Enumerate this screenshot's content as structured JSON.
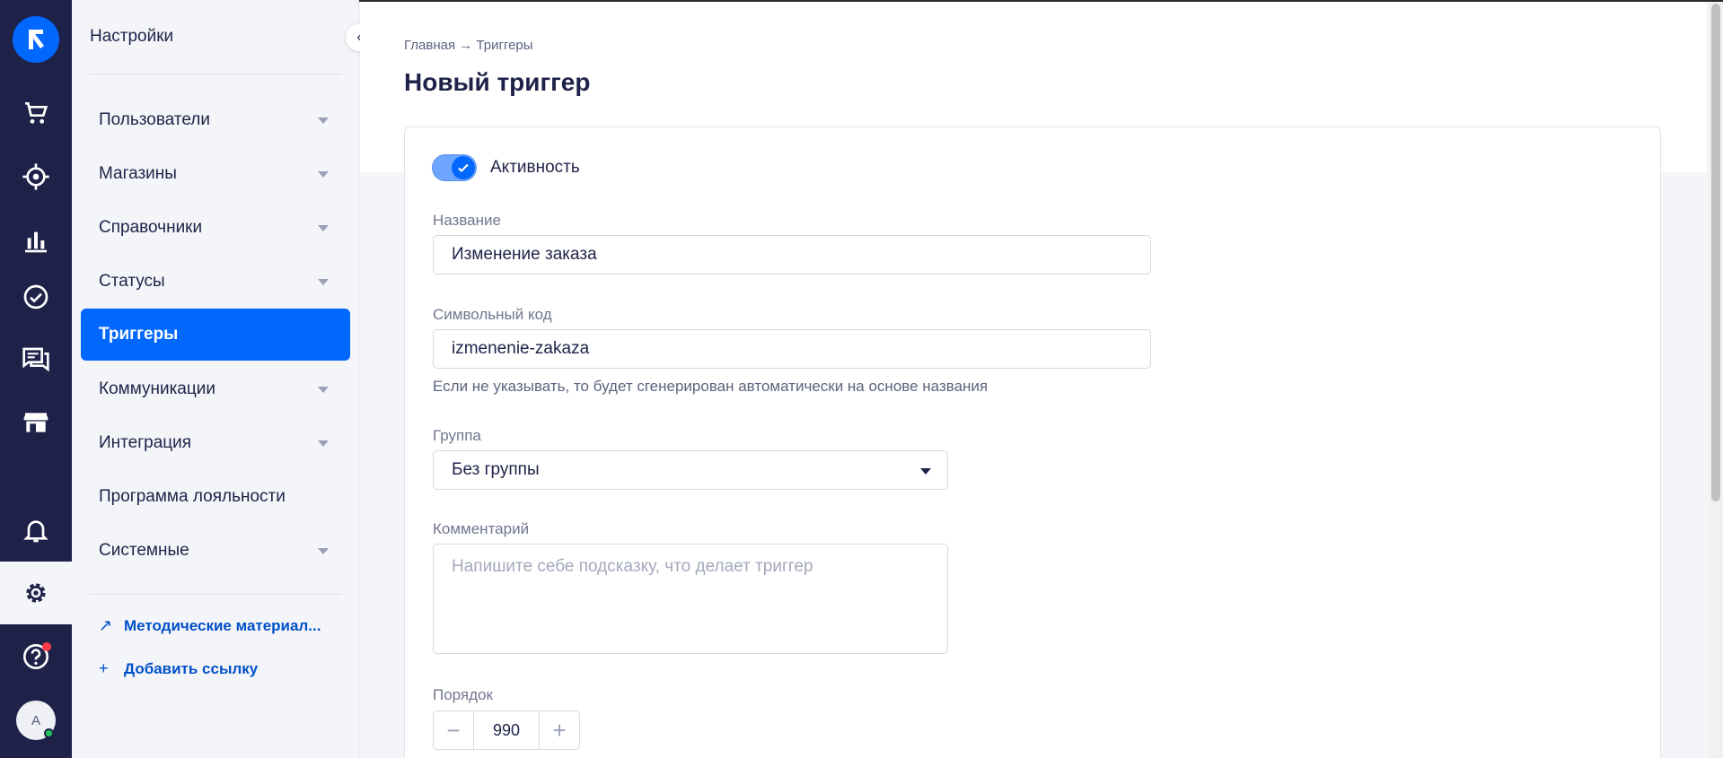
{
  "sidebar": {
    "title": "Настройки",
    "items": [
      {
        "label": "Пользователи",
        "has_submenu": true
      },
      {
        "label": "Магазины",
        "has_submenu": true
      },
      {
        "label": "Справочники",
        "has_submenu": true
      },
      {
        "label": "Статусы",
        "has_submenu": true
      },
      {
        "label": "Триггеры",
        "active": true
      },
      {
        "label": "Коммуникации",
        "has_submenu": true
      },
      {
        "label": "Интеграция",
        "has_submenu": true
      },
      {
        "label": "Программа лояльности"
      },
      {
        "label": "Системные",
        "has_submenu": true
      }
    ],
    "links": [
      {
        "label": "Методические материал...",
        "icon": "arrow-up-right-icon"
      },
      {
        "label": "Добавить ссылку",
        "icon": "plus-icon"
      }
    ]
  },
  "rail": {
    "avatar_initial": "A",
    "icons": [
      "logo-icon",
      "cart-icon",
      "target-icon",
      "bar-chart-icon",
      "check-circle-icon",
      "chat-icon",
      "store-icon",
      "bell-icon",
      "gear-icon",
      "help-icon"
    ]
  },
  "header": {
    "breadcrumb": "Главная → Триггеры",
    "title": "Новый триггер"
  },
  "form": {
    "activity_label": "Активность",
    "activity_on": true,
    "name_label": "Название",
    "name_value": "Изменение заказа",
    "code_label": "Символьный код",
    "code_value": "izmenenie-zakaza",
    "code_hint": "Если не указывать, то будет сгенерирован автоматически на основе названия",
    "group_label": "Группа",
    "group_value": "Без группы",
    "comment_label": "Комментарий",
    "comment_placeholder": "Напишите себе подсказку, что делает триггер",
    "order_label": "Порядок",
    "order_value": "990"
  },
  "colors": {
    "rail_bg": "#1e2248",
    "accent": "#0068ff",
    "link": "#0050c8"
  }
}
